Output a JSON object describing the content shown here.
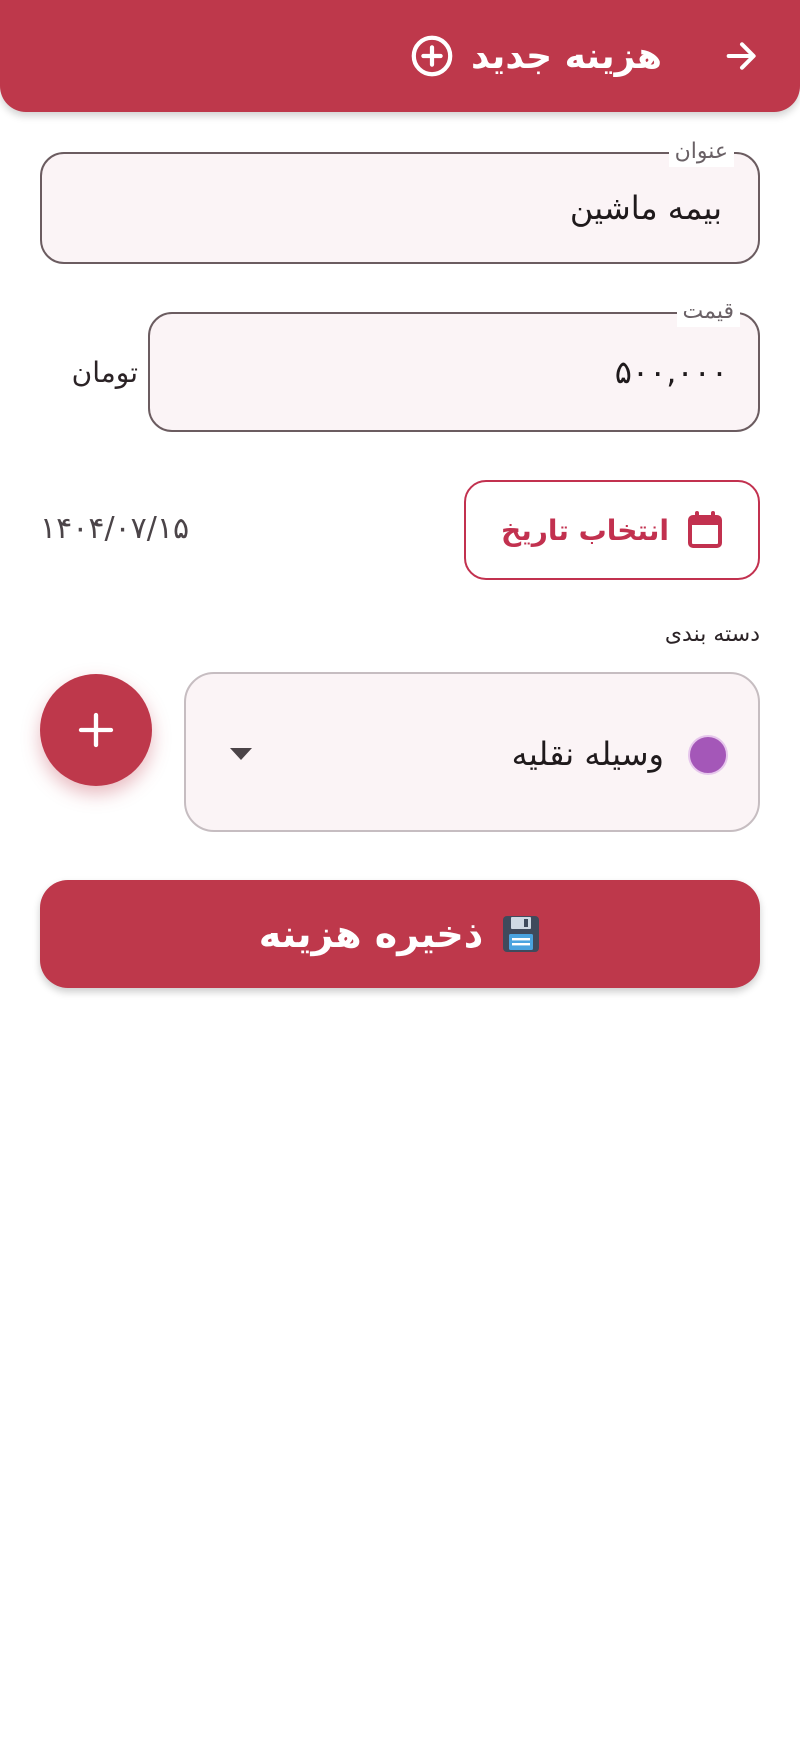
{
  "appbar": {
    "title": "هزینه جدید",
    "back_icon": "arrow-right-icon",
    "title_icon": "plus-circle-icon",
    "color": "#be384b"
  },
  "form": {
    "title_field": {
      "label": "عنوان",
      "value": "بیمه ماشین"
    },
    "price_field": {
      "label": "قیمت",
      "value": "۵۰۰,۰۰۰",
      "currency": "تومان"
    },
    "date": {
      "button_label": "انتخاب تاریخ",
      "button_icon": "calendar-icon",
      "selected": "۱۴۰۴/۰۷/۱۵"
    },
    "category": {
      "section_label": "دسته بندی",
      "selected_name": "وسیله نقلیه",
      "selected_color": "#a457b8",
      "add_icon": "plus-icon"
    },
    "save": {
      "label": "ذخیره هزینه",
      "icon": "floppy-disk-icon"
    }
  }
}
